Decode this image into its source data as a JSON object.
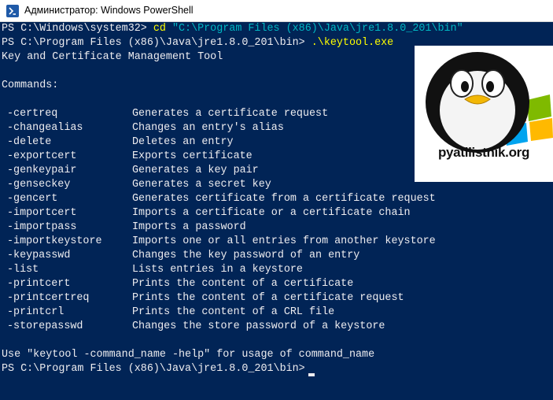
{
  "window": {
    "title": "Администратор: Windows PowerShell",
    "icon": "powershell-icon"
  },
  "console": {
    "line1": {
      "prompt": "PS C:\\Windows\\system32> ",
      "command": "cd",
      "argument": " \"C:\\Program Files (x86)\\Java\\jre1.8.0_201\\bin\""
    },
    "line2": {
      "prompt": "PS C:\\Program Files (x86)\\Java\\jre1.8.0_201\\bin> ",
      "command": ".\\keytool.exe"
    },
    "tool_title": "Key and Certificate Management Tool",
    "commands_header": "Commands:",
    "commands": [
      {
        "name": "-certreq",
        "desc": "Generates a certificate request"
      },
      {
        "name": "-changealias",
        "desc": "Changes an entry's alias"
      },
      {
        "name": "-delete",
        "desc": "Deletes an entry"
      },
      {
        "name": "-exportcert",
        "desc": "Exports certificate"
      },
      {
        "name": "-genkeypair",
        "desc": "Generates a key pair"
      },
      {
        "name": "-genseckey",
        "desc": "Generates a secret key"
      },
      {
        "name": "-gencert",
        "desc": "Generates certificate from a certificate request"
      },
      {
        "name": "-importcert",
        "desc": "Imports a certificate or a certificate chain"
      },
      {
        "name": "-importpass",
        "desc": "Imports a password"
      },
      {
        "name": "-importkeystore",
        "desc": "Imports one or all entries from another keystore"
      },
      {
        "name": "-keypasswd",
        "desc": "Changes the key password of an entry"
      },
      {
        "name": "-list",
        "desc": "Lists entries in a keystore"
      },
      {
        "name": "-printcert",
        "desc": "Prints the content of a certificate"
      },
      {
        "name": "-printcertreq",
        "desc": "Prints the content of a certificate request"
      },
      {
        "name": "-printcrl",
        "desc": "Prints the content of a CRL file"
      },
      {
        "name": "-storepasswd",
        "desc": "Changes the store password of a keystore"
      }
    ],
    "usage": "Use \"keytool -command_name -help\" for usage of command_name",
    "final_prompt": "PS C:\\Program Files (x86)\\Java\\jre1.8.0_201\\bin> "
  },
  "logo": {
    "text": "pyatilistnik.org"
  },
  "colors": {
    "background": "#012456",
    "foreground": "#eeedf0",
    "command": "#ffff00",
    "string": "#00b7c3"
  }
}
